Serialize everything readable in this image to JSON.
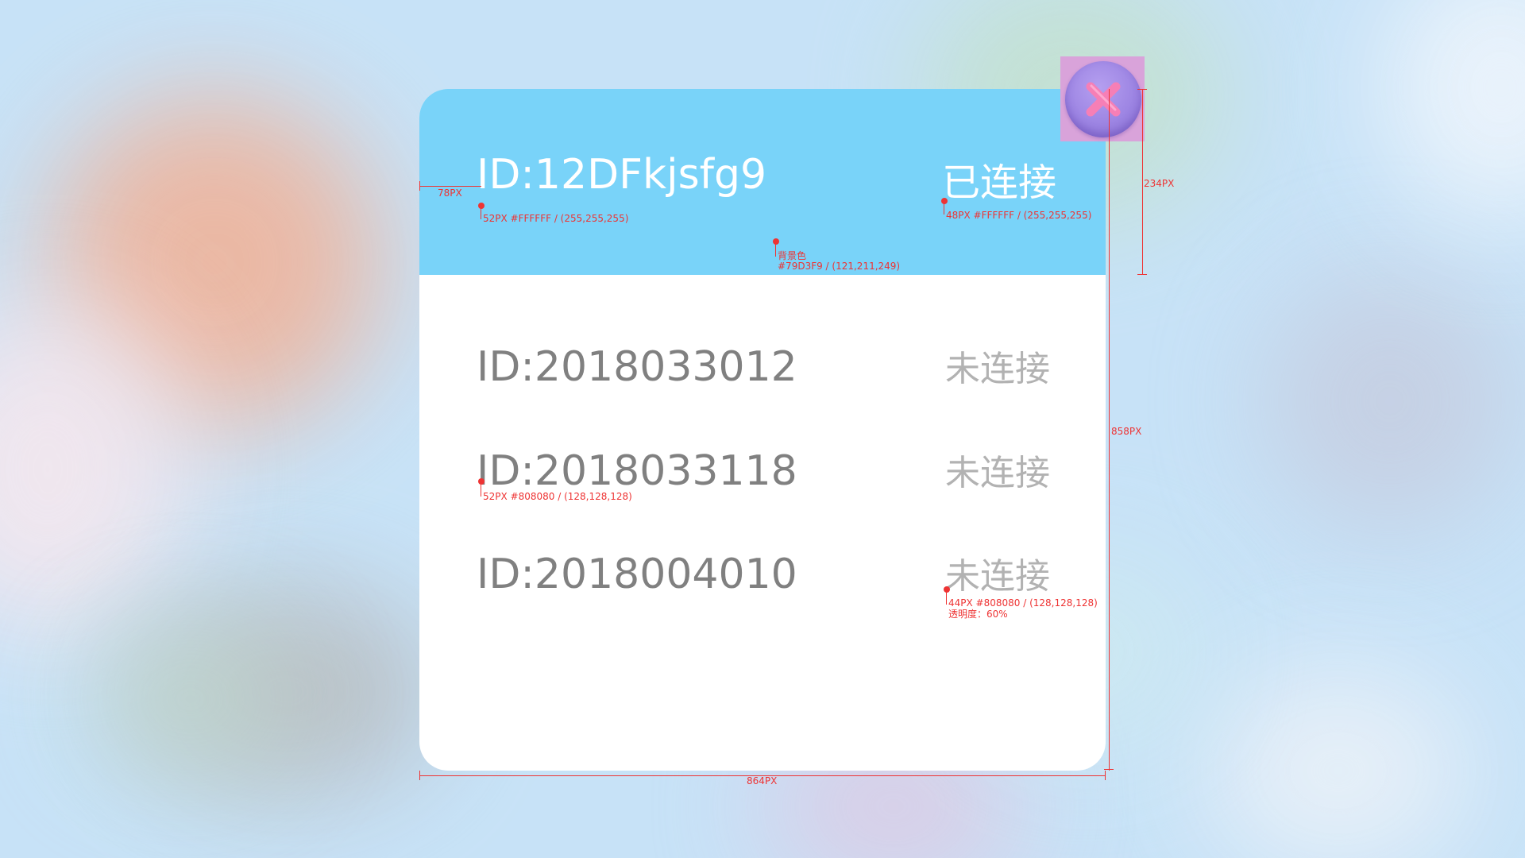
{
  "header": {
    "device_id": "ID:12DFkjsfg9",
    "status": "已连接",
    "background_color": "#79D3F9"
  },
  "devices": [
    {
      "device_id": "ID:2018033012",
      "status": "未连接"
    },
    {
      "device_id": "ID:2018033118",
      "status": "未连接"
    },
    {
      "device_id": "ID:2018004010",
      "status": "未连接"
    }
  ],
  "close_button": {
    "icon": "close-icon"
  },
  "annotations": {
    "left_padding": "78PX",
    "header_id_spec": "52PX #FFFFFF / (255,255,255)",
    "header_status_spec": "48PX #FFFFFF / (255,255,255)",
    "header_bg_label": "背景色",
    "header_bg_spec": "#79D3F9 / (121,211,249)",
    "header_height": "234PX",
    "dialog_height": "858PX",
    "dialog_width": "864PX",
    "row_id_spec": "52PX #808080 / (128,128,128)",
    "row_status_spec": "44PX #808080 / (128,128,128)",
    "row_status_opacity": "透明度：60%"
  },
  "colors": {
    "header_bg": "#79D3F9",
    "header_text": "#FFFFFF",
    "row_text": "#808080",
    "annotation": "#EE3333"
  }
}
